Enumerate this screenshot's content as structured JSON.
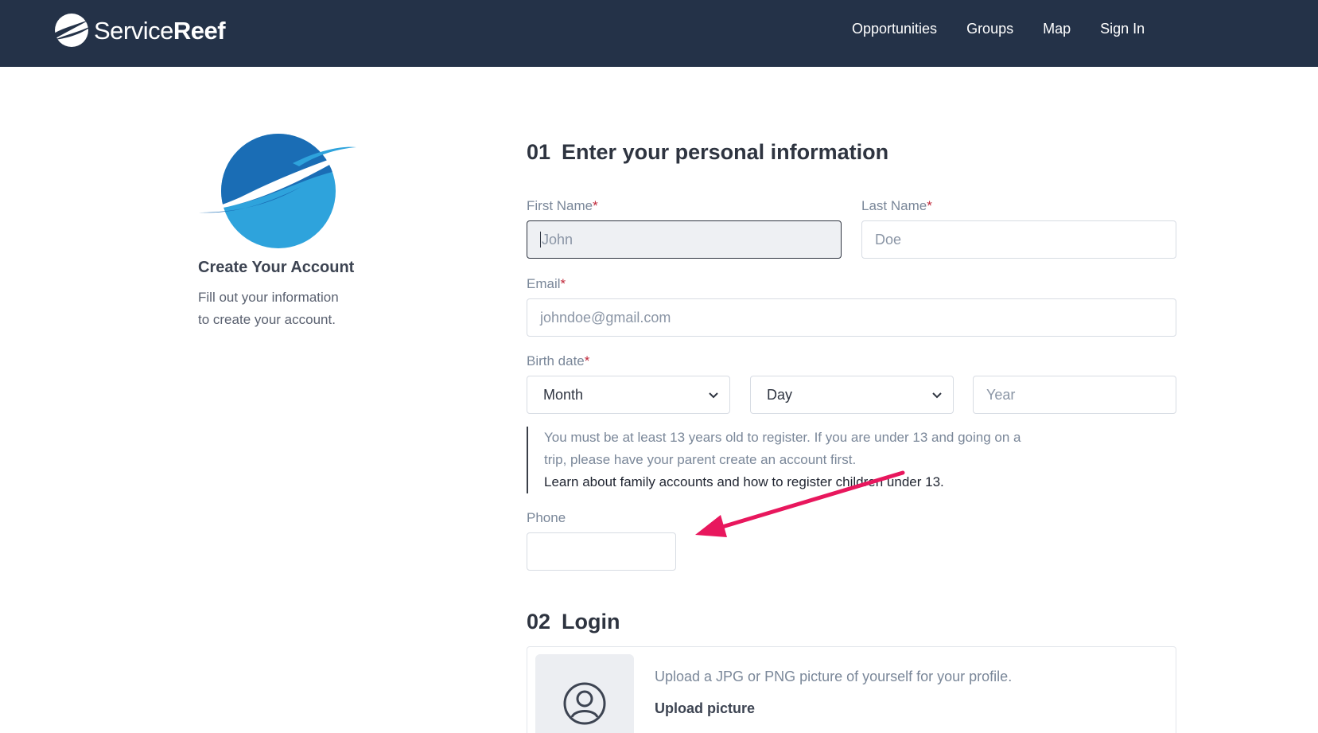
{
  "header": {
    "brand_light": "Service",
    "brand_bold": "Reef",
    "nav": [
      "Opportunities",
      "Groups",
      "Map",
      "Sign In"
    ]
  },
  "left": {
    "title": "Create Your Account",
    "desc_line1": "Fill out your information",
    "desc_line2": "to create your account."
  },
  "section1": {
    "num": "01",
    "title": "Enter your personal information",
    "first_name": {
      "label": "First Name",
      "placeholder": "John"
    },
    "last_name": {
      "label": "Last Name",
      "placeholder": "Doe"
    },
    "email": {
      "label": "Email",
      "placeholder": "johndoe@gmail.com"
    },
    "birth": {
      "label": "Birth date",
      "month": "Month",
      "day": "Day",
      "year_placeholder": "Year"
    },
    "note_line1": "You must be at least 13 years old to register. If you are under 13 and going on a",
    "note_line2": "trip, please have your parent create an account first.",
    "note_link": "Learn about family accounts and how to register children under 13.",
    "phone": {
      "label": "Phone"
    },
    "required_mark": "*"
  },
  "section2": {
    "num": "02",
    "title": "Login",
    "upload_text": "Upload a JPG or PNG picture of yourself for your profile.",
    "upload_link": "Upload picture"
  },
  "icons": {
    "brand": "servicereef-logo-icon",
    "avatar": "user-circle-icon",
    "select": "chevron-down-icon",
    "annotation": "arrow-annotation"
  },
  "colors": {
    "header_bg": "#243248",
    "required": "#c0283a",
    "arrow": "#e8175d",
    "logo_dark": "#1a6db5",
    "logo_light": "#2ea3dc"
  }
}
